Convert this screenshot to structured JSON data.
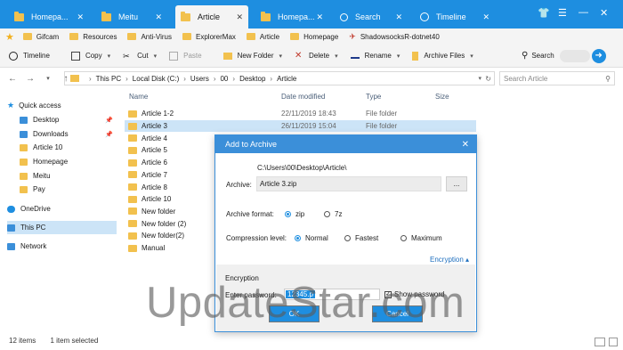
{
  "tabs": [
    {
      "label": "Homepa...",
      "icon": "folder-icon"
    },
    {
      "label": "Meitu",
      "icon": "folder-icon"
    },
    {
      "label": "Article",
      "icon": "folder-icon"
    },
    {
      "label": "Homepa...",
      "icon": "folder-icon"
    },
    {
      "label": "Search",
      "icon": "search-icon"
    },
    {
      "label": "Timeline",
      "icon": "timeline-icon"
    }
  ],
  "favorites": [
    "Gifcam",
    "Resources",
    "Anti-Virus",
    "ExplorerMax",
    "Article",
    "Homepage",
    "ShadowsocksR-dotnet40"
  ],
  "toolbar": {
    "timeline": "Timeline",
    "copy": "Copy",
    "cut": "Cut",
    "paste": "Paste",
    "new_folder": "New Folder",
    "delete": "Delete",
    "rename": "Rename",
    "archive": "Archive Files",
    "search": "Search"
  },
  "address": {
    "crumbs": [
      "This PC",
      "Local Disk (C:)",
      "Users",
      "00",
      "Desktop",
      "Article"
    ],
    "search_placeholder": "Search Article"
  },
  "nav": {
    "quick_access": "Quick access",
    "items": [
      "Desktop",
      "Downloads",
      "Article 10",
      "Homepage",
      "Meitu",
      "Pay"
    ],
    "onedrive": "OneDrive",
    "this_pc": "This PC",
    "network": "Network"
  },
  "columns": {
    "name": "Name",
    "date": "Date modified",
    "type": "Type",
    "size": "Size"
  },
  "files": [
    {
      "name": "Article 1-2",
      "date": "22/11/2019 18:43",
      "type": "File folder"
    },
    {
      "name": "Article 3",
      "date": "26/11/2019 15:04",
      "type": "File folder"
    },
    {
      "name": "Article 4",
      "date": "",
      "type": ""
    },
    {
      "name": "Article 5",
      "date": "",
      "type": ""
    },
    {
      "name": "Article 6",
      "date": "",
      "type": ""
    },
    {
      "name": "Article 7",
      "date": "",
      "type": ""
    },
    {
      "name": "Article 8",
      "date": "",
      "type": ""
    },
    {
      "name": "Article 10",
      "date": "",
      "type": ""
    },
    {
      "name": "New folder",
      "date": "",
      "type": ""
    },
    {
      "name": "New folder (2)",
      "date": "",
      "type": ""
    },
    {
      "name": "New folder(2)",
      "date": "",
      "type": ""
    },
    {
      "name": "Manual",
      "date": "",
      "type": ""
    }
  ],
  "status": {
    "items": "12 items",
    "selected": "1 item selected"
  },
  "dialog": {
    "title": "Add to Archive",
    "path": "C:\\Users\\00\\Desktop\\Article\\",
    "archive_label": "Archive:",
    "archive_value": "Article 3.zip",
    "browse": "...",
    "format_label": "Archive format:",
    "format_zip": "zip",
    "format_7z": "7z",
    "compression_label": "Compression level:",
    "level_normal": "Normal",
    "level_fastest": "Fastest",
    "level_maximum": "Maximum",
    "encryption_toggle": "Encryption ▴",
    "encryption_title": "Encryption",
    "password_label": "Enter password:",
    "password_value": "12345.p",
    "show_password": "Show password",
    "ok": "OK",
    "cancel": "Cancel"
  },
  "watermark": "UpdateStar.com",
  "colors": {
    "accent": "#1e8ee0",
    "selection": "#cce4f7",
    "folder": "#f2c14e"
  }
}
